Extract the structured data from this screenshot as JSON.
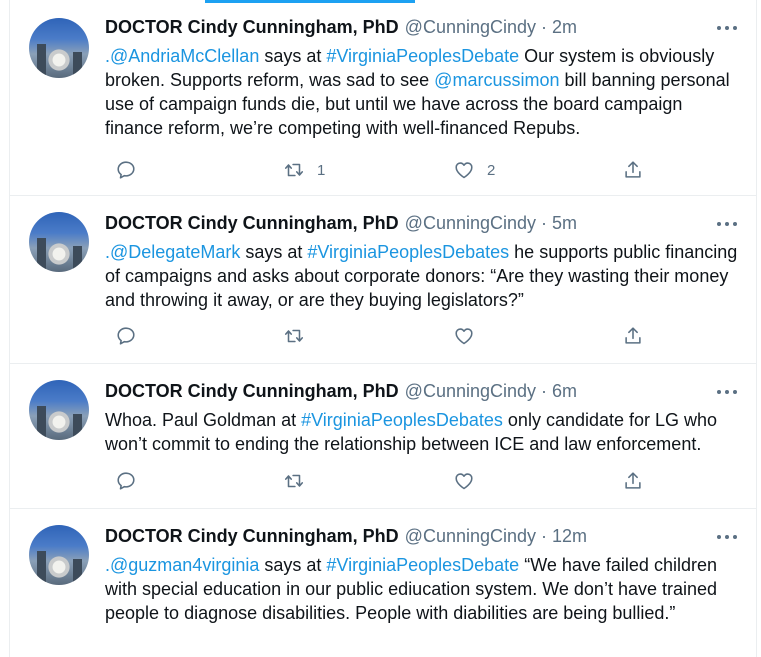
{
  "tweets": [
    {
      "author": {
        "name": "DOCTOR Cindy Cunningham, PhD",
        "handle": "@CunningCindy"
      },
      "separator": "·",
      "time": "2m",
      "text": {
        "mention1": ".@AndriaMcClellan",
        "part1": " says at ",
        "hashtag": "#VirginiaPeoplesDebate",
        "part2": " Our system is obviously broken. Supports reform, was sad to see  ",
        "mention2": "@marcussimon",
        "part3": " bill banning personal use of campaign funds die, but until we have across the board campaign finance reform, we’re competing with well-financed Repubs."
      },
      "retweets": "1",
      "likes": "2"
    },
    {
      "author": {
        "name": "DOCTOR Cindy Cunningham, PhD",
        "handle": "@CunningCindy"
      },
      "separator": "·",
      "time": "5m",
      "text": {
        "mention1": ".@DelegateMark",
        "part1": " says at ",
        "hashtag": "#VirginiaPeoplesDebates",
        "part2": " he supports public financing of campaigns and asks about corporate donors: “Are they wasting their money and throwing it away, or are they buying legislators?”"
      },
      "retweets": "",
      "likes": ""
    },
    {
      "author": {
        "name": "DOCTOR Cindy Cunningham, PhD",
        "handle": "@CunningCindy"
      },
      "separator": "·",
      "time": "6m",
      "text": {
        "part0": "Whoa. Paul Goldman at ",
        "hashtag": "#VirginiaPeoplesDebates",
        "part2": " only candidate for LG who won’t commit to ending the relationship between ICE and law enforcement."
      },
      "retweets": "",
      "likes": ""
    },
    {
      "author": {
        "name": "DOCTOR Cindy Cunningham, PhD",
        "handle": "@CunningCindy"
      },
      "separator": "·",
      "time": "12m",
      "text": {
        "mention1": ".@guzman4virginia",
        "part1": " says at ",
        "hashtag": "#VirginiaPeoplesDebate",
        "part2": " “We have failed children with special education in our public ediucation system. We don’t have trained people to diagnose disabilities. People with diabilities are being bullied.”"
      }
    }
  ],
  "colors": {
    "link": "#1b95e0",
    "muted": "#5b7083",
    "accent": "#1da1f2",
    "divider": "#ebeef0"
  },
  "icons": [
    "reply-icon",
    "retweet-icon",
    "like-icon",
    "share-icon",
    "more-icon"
  ]
}
